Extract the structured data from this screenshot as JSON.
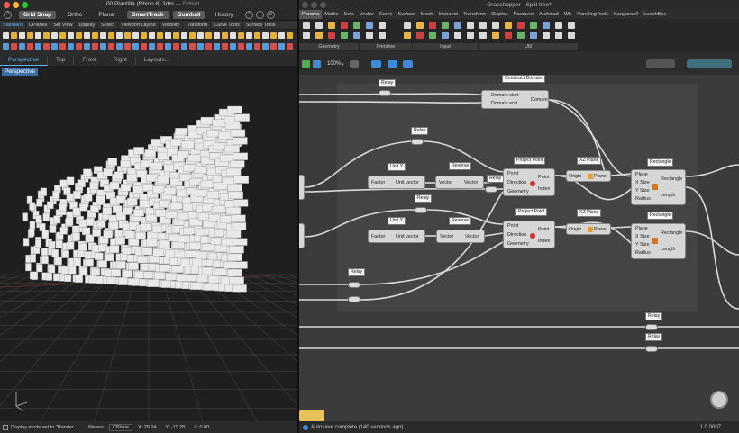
{
  "rhino": {
    "title": "00 Plantilla (Rhino 6).3dm",
    "title_status": "— Edited",
    "toolbar1": [
      "Grid Snap",
      "Ortho",
      "Planar",
      "SmartTrack",
      "Gumball",
      "History"
    ],
    "toolbar1_active": [
      "Grid Snap",
      "SmartTrack",
      "Gumball"
    ],
    "tabs": [
      "Standard",
      "CPlanes",
      "Set View",
      "Display",
      "Select",
      "Viewport Layout",
      "Visibility",
      "Transform",
      "Curve Tools",
      "Surface Tools"
    ],
    "viewport_tabs": [
      "Perspective",
      "Top",
      "Front",
      "Right",
      "Layouts..."
    ],
    "viewport_label": "Perspective",
    "status": {
      "message": "Display mode set to \"Render...",
      "units": "Meters",
      "cplane": "CPlane",
      "x": "X: 29.24",
      "y": "Y: -11.28",
      "z": "Z: 0.00"
    }
  },
  "grasshopper": {
    "title": "Grasshopper - Split tree*",
    "menu": [
      "Params",
      "Maths",
      "Sets",
      "Vector",
      "Curve",
      "Surface",
      "Mesh",
      "Intersect",
      "Transform",
      "Display",
      "Parakeet",
      "Archicad",
      "Wb",
      "PanelingTools",
      "Kangaroo2",
      "LunchBox"
    ],
    "menu_active": "Params",
    "ribbon_groups": [
      "Geometry",
      "Primitive",
      "Input",
      "Util"
    ],
    "zoom": "100%",
    "footer_status": "Autosave complete (140 seconds ago)",
    "version": "1.0.0007",
    "nodes": {
      "construct_domain": {
        "title": "Construct Domain",
        "tag": "Construct Domain",
        "in1": "Domain start",
        "in2": "Domain end",
        "out": "Domain"
      },
      "unit_y": {
        "tag": "Unit Y",
        "in": "Factor",
        "out": "Unit vector"
      },
      "reverse": {
        "tag": "Reverse",
        "in": "Vector",
        "out": "Vector"
      },
      "project_point": {
        "tag": "Project Point",
        "in1": "Point",
        "in2": "Direction",
        "in3": "Geometry",
        "out1": "Point",
        "out2": "Index"
      },
      "xz_plane": {
        "tag": "XZ Plane",
        "in": "Origin",
        "out": "Plane"
      },
      "rectangle": {
        "tag": "Rectangle",
        "in1": "Plane",
        "in2": "X Size",
        "in3": "Y Size",
        "in4": "Radius",
        "out1": "Rectangle",
        "out2": "Length"
      },
      "relay": "Relay"
    }
  }
}
